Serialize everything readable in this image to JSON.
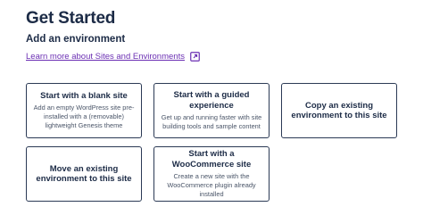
{
  "header": {
    "title": "Get Started",
    "subtitle": "Add an environment",
    "learn_link": "Learn more about Sites and Environments",
    "learn_icon": "external-link-icon",
    "link_color": "#6b2fb3"
  },
  "cards": {
    "blank": {
      "title": "Start with a blank site",
      "description": "Add an empty WordPress site pre-installed with a (removable) lightweight Genesis theme"
    },
    "guided": {
      "title": "Start with a guided experience",
      "description": "Get up and running faster with site building tools and sample content"
    },
    "copy": {
      "title": "Copy an existing environment to this site"
    },
    "move": {
      "title": "Move an existing environment to this site"
    },
    "woo": {
      "title": "Start with a WooCommerce site",
      "description": "Create a new site with the WooCommerce plugin already installed"
    }
  }
}
